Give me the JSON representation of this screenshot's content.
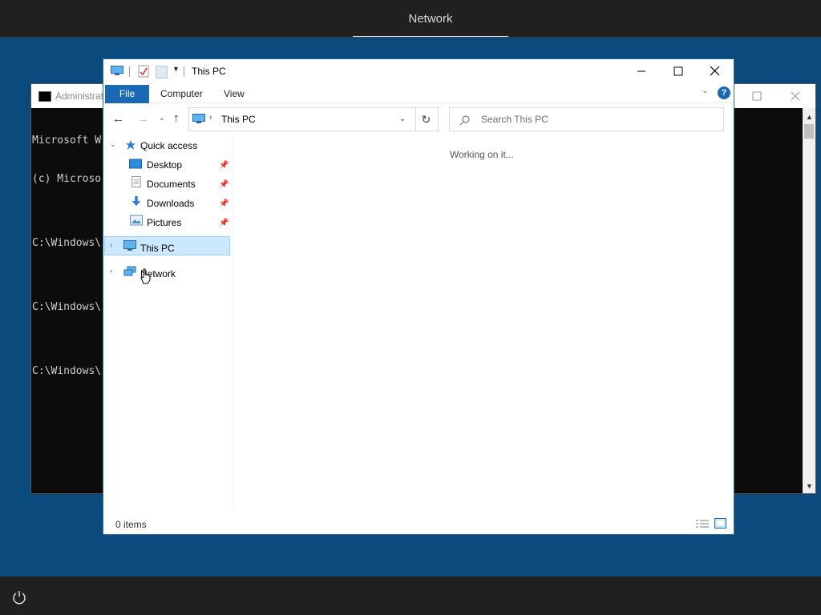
{
  "topbar": {
    "tab_label": "Network"
  },
  "colors": {
    "desktop_bg": "#0b4a7d",
    "accent": "#1a69b5",
    "selection": "#cce8ff"
  },
  "cmd": {
    "title": "Administrati",
    "lines": [
      "Microsoft W",
      "(c) Microso",
      "",
      "C:\\Windows\\",
      "",
      "C:\\Windows\\",
      "",
      "C:\\Windows\\"
    ]
  },
  "explorer": {
    "title": "This PC",
    "ribbon": {
      "file": "File",
      "tabs": [
        "Computer",
        "View"
      ],
      "help": "?"
    },
    "address": {
      "path": "This PC"
    },
    "search": {
      "placeholder": "Search This PC"
    },
    "nav": {
      "quick_access": "Quick access",
      "items": [
        "Desktop",
        "Documents",
        "Downloads",
        "Pictures"
      ],
      "this_pc": "This PC",
      "network": "Network"
    },
    "content_status": "Working on it...",
    "status": {
      "items": "0 items"
    }
  },
  "icons": [
    "power-icon",
    "pc-icon",
    "search-icon",
    "pin-icon",
    "refresh-icon",
    "help-icon"
  ]
}
